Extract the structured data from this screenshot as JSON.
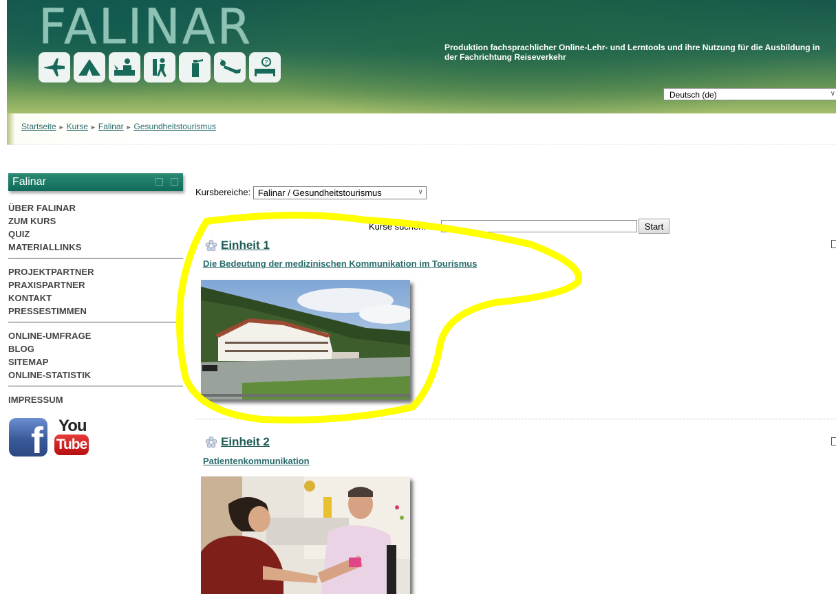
{
  "header": {
    "logo_text": "FALINAR",
    "logo_icons": [
      "airplane-icon",
      "tent-icon",
      "reception-icon",
      "hiker-icon",
      "fire-extinguisher-icon",
      "diver-icon",
      "hotel-bed-icon"
    ],
    "tagline": "Produktion fachsprachlicher Online-Lehr- und Lerntools und ihre Nutzung für die Ausbildung in der Fachrichtung Reiseverkehr",
    "language_selected": "Deutsch (de)"
  },
  "breadcrumb": [
    "Startseite",
    "Kurse",
    "Falinar",
    "Gesundheitstourismus"
  ],
  "sidebar": {
    "block_title": "Falinar",
    "groups": [
      [
        "ÜBER FALINAR",
        "ZUM KURS",
        "QUIZ",
        "MATERIALLINKS"
      ],
      [
        "PROJEKTPARTNER",
        "PRAXISPARTNER",
        "KONTAKT",
        "PRESSESTIMMEN"
      ],
      [
        "ONLINE-UMFRAGE",
        "BLOG",
        "SITEMAP",
        "ONLINE-STATISTIK"
      ],
      [
        "IMPRESSUM"
      ]
    ],
    "social": {
      "facebook": "f",
      "youtube_top": "You",
      "youtube_bottom": "Tube"
    }
  },
  "main": {
    "kursbereiche_label": "Kursbereiche:",
    "kursbereiche_value": "Falinar / Gesundheitstourismus",
    "search_label": "Kurse suchen:",
    "search_value": "",
    "search_button": "Start",
    "units": [
      {
        "title": "Einheit 1",
        "subtitle": "Die Bedeutung der medizinischen Kommunikation im Tourismus",
        "image": "hotel-photo"
      },
      {
        "title": "Einheit 2",
        "subtitle": "Patientenkommunikation",
        "image": "patient-photo"
      }
    ]
  },
  "colors": {
    "accent": "#1d5a55",
    "link": "#2a6b6b",
    "highlight": "#ffff00",
    "header_dark": "#18574b"
  }
}
